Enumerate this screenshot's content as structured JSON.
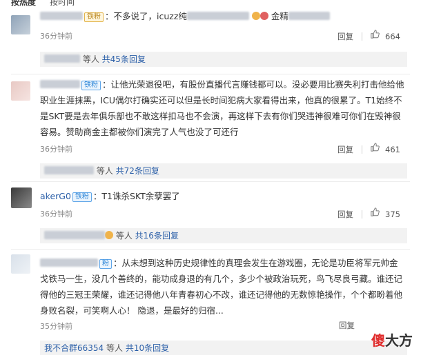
{
  "sort": {
    "hot": "按热度",
    "time": "按时间"
  },
  "comments": [
    {
      "badge": "铁粉",
      "text_a": "：不多说了，icuzz纯",
      "text_b": "金精",
      "time": "36分钟前",
      "reply": "回复",
      "likes": "664",
      "replybar": {
        "who_suffix": "等人",
        "count_text": "共45条回复"
      }
    },
    {
      "badge": "铁粉",
      "text": "：让他光荣退役吧，有股份直播代言赚钱都可以。没必要用比赛失利打击他给他职业生涯抹黑，ICU偶尔打确实还可以但是长时间犯病大家看得出来，他真的很累了。T1始终不是SKT要是去年俱乐部也不敢这样扣马也不会演，再这样下去有你们哭违神很难可你们在毁神很容易。赞助商金主都被你们演完了人气也没了可还行",
      "time": "36分钟前",
      "reply": "回复",
      "likes": "461",
      "replybar": {
        "who_suffix": "等人",
        "count_text": "共72条回复"
      }
    },
    {
      "name": "akerG0",
      "badge": "铁粉",
      "text": "：T1诛杀SKT余孽罢了",
      "time": "36分钟前",
      "reply": "回复",
      "likes": "375",
      "replybar": {
        "who_suffix": "等人",
        "count_text": "共16条回复"
      }
    },
    {
      "badge": "粉",
      "text": "：从未想到这种历史规律性的真理会发生在游戏圈，无论是功臣将军元帅金戈铁马一生，没几个善终的，能功成身退的有几个，多少个被政治玩死，鸟飞尽良弓藏。谁还记得他的三冠王荣耀，谁还记得他八年青春初心不改，谁还记得他的无数惊艳操作，个个都盼着他身败名裂，可笑啊人心！  隐退，是最好的归宿...",
      "time": "35分钟前",
      "reply": "回复",
      "replybar": {
        "name": "我不合群66354",
        "who_suffix": "等人",
        "count_text": "共10条回复"
      }
    }
  ],
  "watermark": {
    "part1": "傻",
    "part2": "大方"
  },
  "colors": {
    "link": "#2b5fa8",
    "badge_blue": "#2e86d8",
    "badge_gold": "#b9861f",
    "watermark_red": "#e02c2c"
  }
}
